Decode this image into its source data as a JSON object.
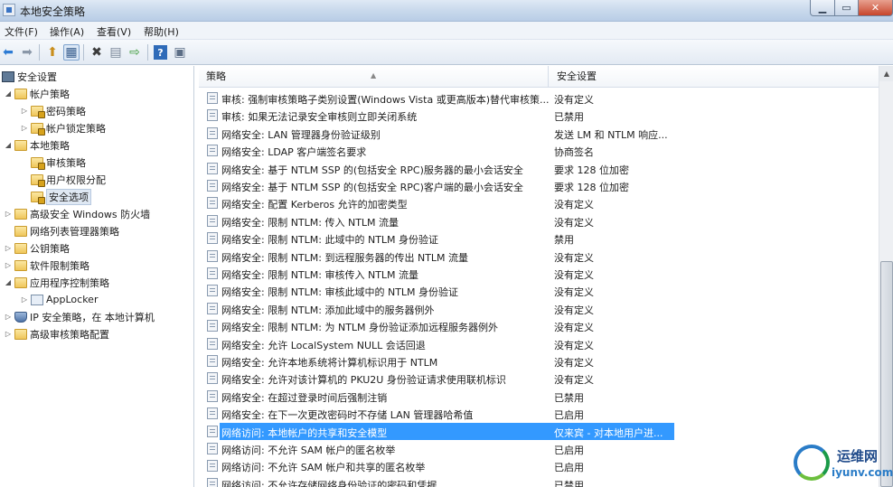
{
  "window": {
    "title": "本地安全策略"
  },
  "menu": [
    "文件(F)",
    "操作(A)",
    "查看(V)",
    "帮助(H)"
  ],
  "toolbar": {
    "icons": [
      "back-icon",
      "forward-icon",
      "up-folder-icon",
      "show-tree-icon",
      "delete-icon",
      "properties-icon",
      "export-icon",
      "help-icon",
      "console-icon"
    ]
  },
  "tree": [
    {
      "label": "安全设置",
      "icon": "computer-icon",
      "level": 0,
      "expander": ""
    },
    {
      "label": "帐户策略",
      "icon": "folder-icon",
      "level": 1,
      "expander": "open"
    },
    {
      "label": "密码策略",
      "icon": "folder-lock-icon",
      "level": 2,
      "expander": "closed"
    },
    {
      "label": "帐户锁定策略",
      "icon": "folder-lock-icon",
      "level": 2,
      "expander": "closed"
    },
    {
      "label": "本地策略",
      "icon": "folder-icon",
      "level": 1,
      "expander": "open"
    },
    {
      "label": "审核策略",
      "icon": "folder-lock-icon",
      "level": 2,
      "expander": ""
    },
    {
      "label": "用户权限分配",
      "icon": "folder-lock-icon",
      "level": 2,
      "expander": ""
    },
    {
      "label": "安全选项",
      "icon": "folder-lock-icon",
      "level": 2,
      "expander": "",
      "selected": true
    },
    {
      "label": "高级安全 Windows 防火墙",
      "icon": "folder-icon",
      "level": 1,
      "expander": "closed"
    },
    {
      "label": "网络列表管理器策略",
      "icon": "folder-icon",
      "level": 1,
      "expander": ""
    },
    {
      "label": "公钥策略",
      "icon": "folder-icon",
      "level": 1,
      "expander": "closed"
    },
    {
      "label": "软件限制策略",
      "icon": "folder-icon",
      "level": 1,
      "expander": "closed"
    },
    {
      "label": "应用程序控制策略",
      "icon": "folder-icon",
      "level": 1,
      "expander": "open"
    },
    {
      "label": "AppLocker",
      "icon": "applocker-icon",
      "level": 2,
      "expander": "closed"
    },
    {
      "label": "IP 安全策略，在 本地计算机",
      "icon": "ip-security-icon",
      "level": 1,
      "expander": "closed"
    },
    {
      "label": "高级审核策略配置",
      "icon": "folder-icon",
      "level": 1,
      "expander": "closed"
    }
  ],
  "columns": {
    "policy": "策略",
    "setting": "安全设置"
  },
  "rows": [
    {
      "policy": "审核: 强制审核策略子类别设置(Windows Vista 或更高版本)替代审核策...",
      "setting": "没有定义"
    },
    {
      "policy": "审核: 如果无法记录安全审核则立即关闭系统",
      "setting": "已禁用"
    },
    {
      "policy": "网络安全: LAN 管理器身份验证级别",
      "setting": "发送 LM 和 NTLM 响应..."
    },
    {
      "policy": "网络安全: LDAP 客户端签名要求",
      "setting": "协商签名"
    },
    {
      "policy": "网络安全: 基于 NTLM SSP 的(包括安全 RPC)服务器的最小会话安全",
      "setting": "要求 128 位加密"
    },
    {
      "policy": "网络安全: 基于 NTLM SSP 的(包括安全 RPC)客户端的最小会话安全",
      "setting": "要求 128 位加密"
    },
    {
      "policy": "网络安全: 配置 Kerberos 允许的加密类型",
      "setting": "没有定义"
    },
    {
      "policy": "网络安全: 限制 NTLM: 传入 NTLM 流量",
      "setting": "没有定义"
    },
    {
      "policy": "网络安全: 限制 NTLM: 此域中的 NTLM 身份验证",
      "setting": "禁用"
    },
    {
      "policy": "网络安全: 限制 NTLM: 到远程服务器的传出 NTLM 流量",
      "setting": "没有定义"
    },
    {
      "policy": "网络安全: 限制 NTLM: 审核传入 NTLM 流量",
      "setting": "没有定义"
    },
    {
      "policy": "网络安全: 限制 NTLM: 审核此域中的 NTLM 身份验证",
      "setting": "没有定义"
    },
    {
      "policy": "网络安全: 限制 NTLM: 添加此域中的服务器例外",
      "setting": "没有定义"
    },
    {
      "policy": "网络安全: 限制 NTLM: 为 NTLM 身份验证添加远程服务器例外",
      "setting": "没有定义"
    },
    {
      "policy": "网络安全: 允许 LocalSystem NULL 会话回退",
      "setting": "没有定义"
    },
    {
      "policy": "网络安全: 允许本地系统将计算机标识用于 NTLM",
      "setting": "没有定义"
    },
    {
      "policy": "网络安全: 允许对该计算机的 PKU2U 身份验证请求使用联机标识",
      "setting": "没有定义"
    },
    {
      "policy": "网络安全: 在超过登录时间后强制注销",
      "setting": "已禁用"
    },
    {
      "policy": "网络安全: 在下一次更改密码时不存储 LAN 管理器哈希值",
      "setting": "已启用"
    },
    {
      "policy": "网络访问: 本地帐户的共享和安全模型",
      "setting": "仅来宾 - 对本地用户进...",
      "selected": true
    },
    {
      "policy": "网络访问: 不允许 SAM 帐户的匿名枚举",
      "setting": "已启用"
    },
    {
      "policy": "网络访问: 不允许 SAM 帐户和共享的匿名枚举",
      "setting": "已启用"
    },
    {
      "policy": "网络访问: 不允许存储网络身份验证的密码和凭据",
      "setting": "已禁用"
    }
  ],
  "watermark": {
    "line1": "运维网",
    "line2": "iyunv.com"
  }
}
